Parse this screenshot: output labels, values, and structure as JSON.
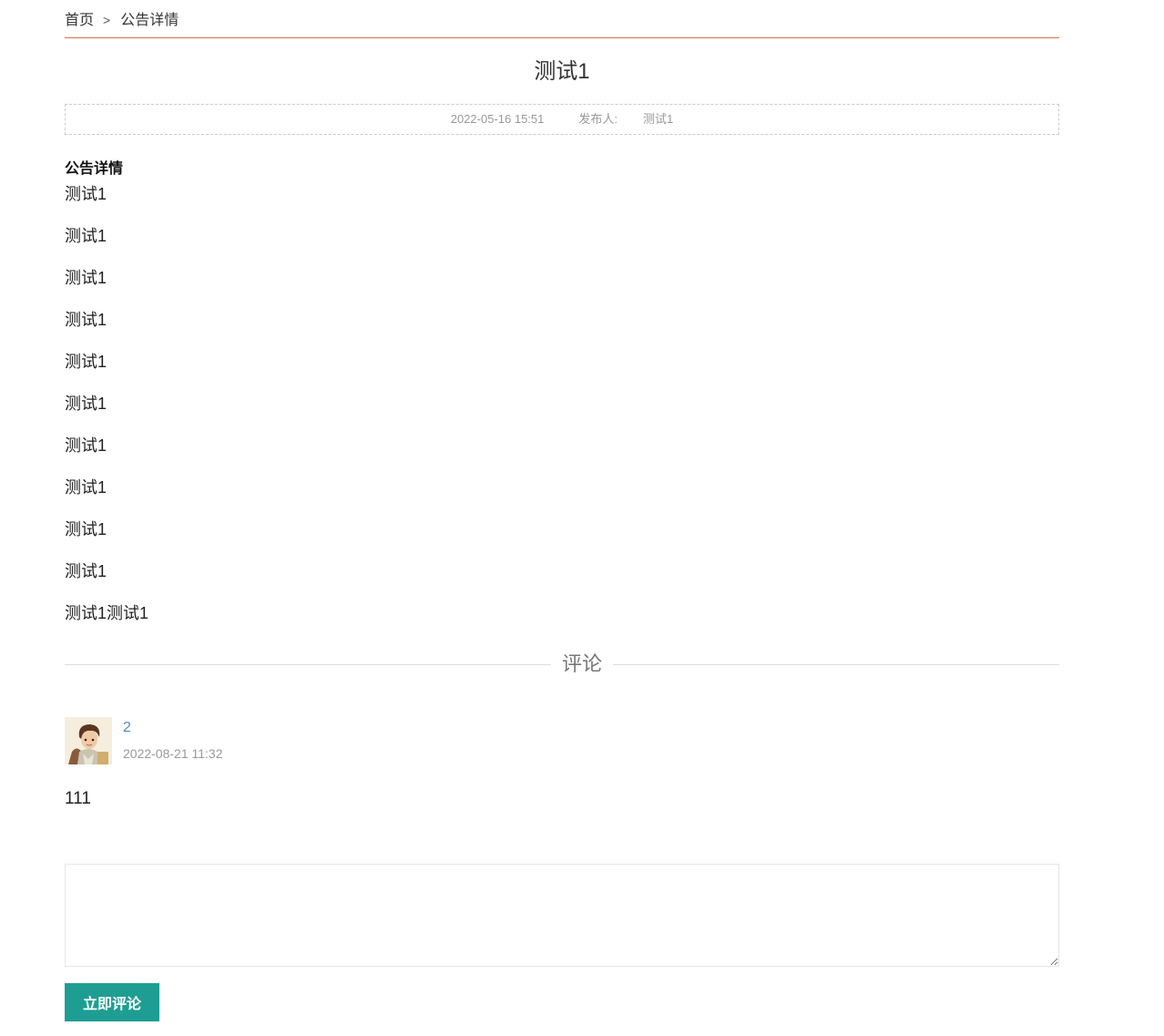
{
  "breadcrumb": {
    "home": "首页",
    "separator": ">",
    "current": "公告详情"
  },
  "notice": {
    "title": "测试1",
    "date": "2022-05-16 15:51",
    "publisher_label": "发布人:",
    "publisher": "测试1",
    "section_heading": "公告详情",
    "paragraphs": [
      "测试1",
      "测试1",
      "测试1",
      "测试1",
      "测试1",
      "测试1",
      "测试1",
      "测试1",
      "测试1",
      "测试1",
      "测试1测试1"
    ]
  },
  "comments_section": {
    "heading": "评论",
    "items": [
      {
        "user": "2",
        "time": "2022-08-21 11:32",
        "text": "111",
        "avatar_icon": "user-avatar"
      }
    ]
  },
  "comment_form": {
    "placeholder": "",
    "submit_label": "立即评论"
  },
  "colors": {
    "accent_line": "#e36f3a",
    "button": "#1e9e93",
    "username": "#4a8fb7"
  }
}
